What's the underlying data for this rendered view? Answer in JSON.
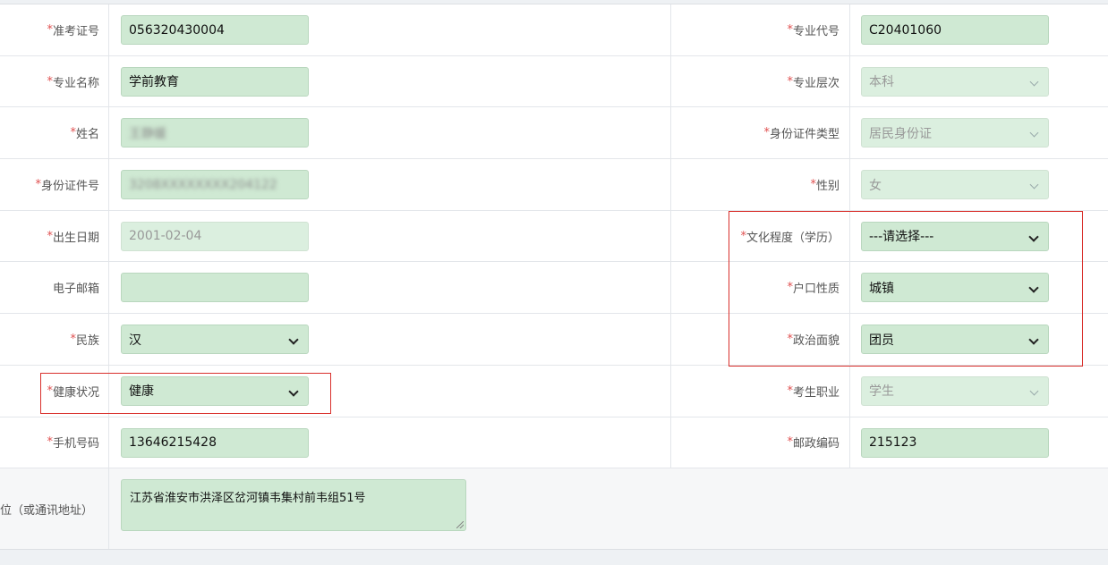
{
  "form": {
    "rows": [
      {
        "left": {
          "label": "准考证号",
          "required": true,
          "value": "056320430004",
          "disabled": false,
          "select": false
        },
        "right": {
          "label": "专业代号",
          "required": true,
          "value": "C20401060",
          "disabled": false,
          "select": false
        }
      },
      {
        "left": {
          "label": "专业名称",
          "required": true,
          "value": "学前教育",
          "disabled": false,
          "select": false
        },
        "right": {
          "label": "专业层次",
          "required": true,
          "value": "本科",
          "disabled": true,
          "select": true
        }
      },
      {
        "left": {
          "label": "姓名",
          "required": true,
          "value": "王静媛",
          "disabled": false,
          "select": false,
          "redacted": true
        },
        "right": {
          "label": "身份证件类型",
          "required": true,
          "value": "居民身份证",
          "disabled": true,
          "select": true
        }
      },
      {
        "left": {
          "label": "身份证件号",
          "required": true,
          "value": "3208XXXXXXXX204122",
          "disabled": false,
          "select": false,
          "redacted": true
        },
        "right": {
          "label": "性别",
          "required": true,
          "value": "女",
          "disabled": true,
          "select": true
        }
      },
      {
        "left": {
          "label": "出生日期",
          "required": true,
          "value": "2001-02-04",
          "disabled": true,
          "select": false
        },
        "right": {
          "label": "文化程度（学历）",
          "required": true,
          "value": "---请选择---",
          "disabled": false,
          "select": true
        }
      },
      {
        "left": {
          "label": "电子邮箱",
          "required": false,
          "value": "",
          "disabled": false,
          "select": false
        },
        "right": {
          "label": "户口性质",
          "required": true,
          "value": "城镇",
          "disabled": false,
          "select": true
        }
      },
      {
        "left": {
          "label": "民族",
          "required": true,
          "value": "汉",
          "disabled": false,
          "select": true
        },
        "right": {
          "label": "政治面貌",
          "required": true,
          "value": "团员",
          "disabled": false,
          "select": true
        }
      },
      {
        "left": {
          "label": "健康状况",
          "required": true,
          "value": "健康",
          "disabled": false,
          "select": true
        },
        "right": {
          "label": "考生职业",
          "required": true,
          "value": "学生",
          "disabled": true,
          "select": true
        }
      },
      {
        "left": {
          "label": "手机号码",
          "required": true,
          "value": "13646215428",
          "disabled": false,
          "select": false
        },
        "right": {
          "label": "邮政编码",
          "required": true,
          "value": "215123",
          "disabled": false,
          "select": false
        }
      }
    ],
    "address": {
      "label": "单位（或通讯地址）",
      "value": "江苏省淮安市洪泽区岔河镇韦集村前韦组51号"
    }
  },
  "colors": {
    "field_bg": "#cfe9d3",
    "highlight_border": "#d9302c",
    "required_star": "#e05050"
  }
}
